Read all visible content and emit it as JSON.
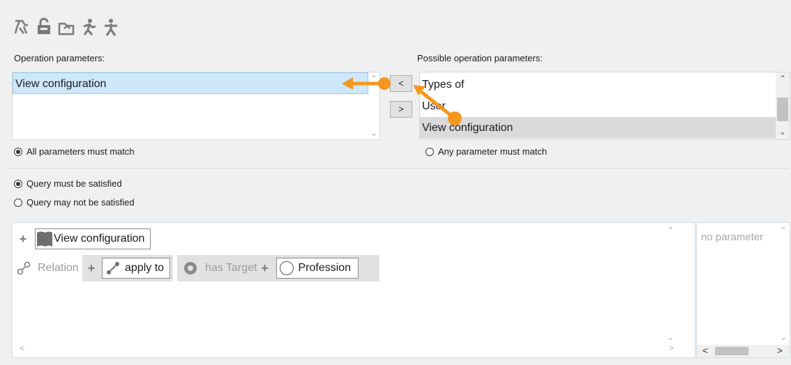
{
  "labels": {
    "operation_parameters": "Operation parameters:",
    "possible_operation_parameters": "Possible operation parameters:"
  },
  "operation_parameters": {
    "items": [
      "View configuration"
    ]
  },
  "possible_parameters": {
    "items": [
      "Types of",
      "User",
      "View configuration"
    ],
    "selected_index": 2
  },
  "buttons": {
    "add": "<",
    "remove": ">"
  },
  "match_mode": {
    "all": "All parameters must match",
    "any": "Any parameter must match",
    "selected": "all"
  },
  "query_mode": {
    "satisfied": "Query must be satisfied",
    "not_satisfied": "Query may not be satisfied",
    "selected": "satisfied"
  },
  "query_graph": {
    "root_label": "View configuration",
    "relation_label": "Relation",
    "relation_value": "apply to",
    "has_target_label": "has Target",
    "target_value": "Profession"
  },
  "side_panel": {
    "placeholder": "no parameter"
  },
  "colors": {
    "accent_orange": "#f5961e",
    "selection_blue": "#cde8fb"
  }
}
